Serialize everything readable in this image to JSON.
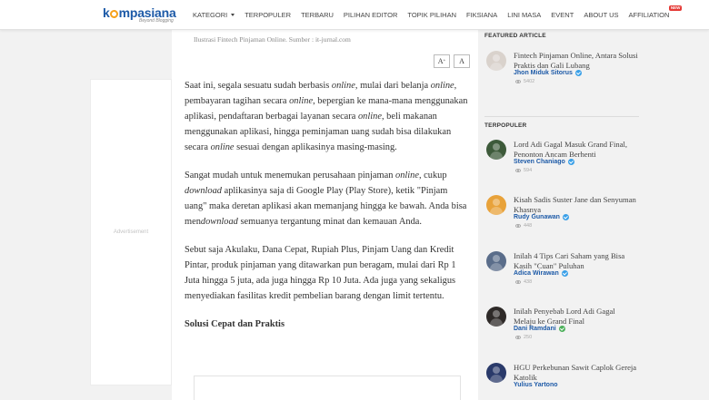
{
  "brand": {
    "logo_prefix": "k",
    "logo_suffix": "mpasiana",
    "tagline": "Beyond Blogging",
    "primary_color": "#1d5aa7",
    "accent_color": "#f6a21d"
  },
  "nav": {
    "items": [
      {
        "label": "KATEGORI",
        "has_dropdown": true
      },
      {
        "label": "TERPOPULER"
      },
      {
        "label": "TERBARU"
      },
      {
        "label": "PILIHAN EDITOR"
      },
      {
        "label": "TOPIK PILIHAN"
      },
      {
        "label": "FIKSIANA"
      },
      {
        "label": "LINI MASA"
      },
      {
        "label": "EVENT"
      },
      {
        "label": "ABOUT US"
      },
      {
        "label": "AFFILIATION",
        "badge": "NEW"
      }
    ]
  },
  "article": {
    "image_caption": "Ilustrasi Fintech Pinjaman Online. Sumber : it-jurnal.com",
    "font_increase_label": "A",
    "font_increase_sup": "+",
    "font_default_label": "A",
    "paragraphs": [
      {
        "parts": [
          {
            "t": "Saat ini, segala sesuatu sudah berbasis "
          },
          {
            "t": "online",
            "i": true
          },
          {
            "t": ", mulai dari belanja "
          },
          {
            "t": "online",
            "i": true
          },
          {
            "t": ", pembayaran tagihan secara "
          },
          {
            "t": "online",
            "i": true
          },
          {
            "t": ", bepergian ke mana-mana menggunakan aplikasi, pendaftaran berbagai layanan secara "
          },
          {
            "t": "online",
            "i": true
          },
          {
            "t": ", beli makanan menggunakan aplikasi, hingga peminjaman uang sudah bisa dilakukan secara "
          },
          {
            "t": "online",
            "i": true
          },
          {
            "t": " sesuai dengan aplikasinya masing-masing."
          }
        ]
      },
      {
        "parts": [
          {
            "t": "Sangat mudah untuk menemukan perusahaan pinjaman "
          },
          {
            "t": "online",
            "i": true
          },
          {
            "t": ", cukup "
          },
          {
            "t": "download",
            "i": true
          },
          {
            "t": " aplikasinya saja di Google Play (Play Store), ketik \"Pinjam uang\" maka deretan aplikasi akan memanjang hingga ke bawah. Anda bisa men"
          },
          {
            "t": "download",
            "i": true
          },
          {
            "t": " semuanya tergantung minat dan kemauan Anda."
          }
        ]
      },
      {
        "parts": [
          {
            "t": "Sebut saja Akulaku, Dana Cepat, Rupiah Plus, Pinjam Uang dan Kredit Pintar, produk pinjaman yang ditawarkan pun beragam, mulai dari Rp 1 Juta hingga 5 juta, ada juga hingga Rp 10 Juta. Ada juga yang sekaligus menyediakan fasilitas kredit pembelian barang dengan limit tertentu."
          }
        ]
      }
    ],
    "subheading": "Solusi Cepat dan Praktis"
  },
  "ad": {
    "label": "Advertisement"
  },
  "sidebar": {
    "featured_title": "FEATURED ARTICLE",
    "popular_title": "TERPOPULER",
    "verified_colors": {
      "blue": "#3aa0e8",
      "green": "#4cb05a"
    },
    "featured": [
      {
        "title": "Fintech Pinjaman Online, Antara Solusi Praktis dan Gali Lubang",
        "author": "Jhon Miduk Sitorus",
        "verified": "blue",
        "views": "5402",
        "avatar_color": "#d9d2cc"
      }
    ],
    "popular": [
      {
        "title": "Lord Adi Gagal Masuk Grand Final, Penonton Ancam Berhenti",
        "author": "Steven Chaniago",
        "verified": "blue",
        "views": "594",
        "avatar_color": "#3d5a3a"
      },
      {
        "title": "Kisah Sadis Suster Jane dan Senyuman Khasnya",
        "author": "Rudy Gunawan",
        "verified": "blue",
        "views": "448",
        "avatar_color": "#e8a23a"
      },
      {
        "title": "Inilah 4 Tips Cari Saham yang Bisa Kasih \"Cuan\" Puluhan",
        "author": "Adica Wirawan",
        "verified": "blue",
        "views": "438",
        "avatar_color": "#5a6d8a"
      },
      {
        "title": "Inilah Penyebab Lord Adi Gagal Melaju ke Grand Final",
        "author": "Dani Ramdani",
        "verified": "green",
        "views": "250",
        "avatar_color": "#2e2a28"
      },
      {
        "title": "HGU Perkebunan Sawit Caplok Gereja Katolik",
        "author": "Yulius Yartono",
        "verified": "",
        "views": "",
        "avatar_color": "#2a3a6a"
      }
    ]
  }
}
